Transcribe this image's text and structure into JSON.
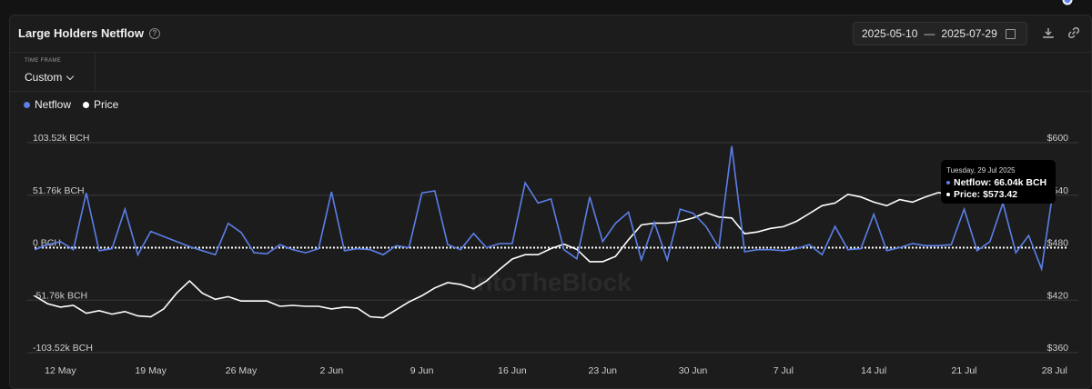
{
  "header": {
    "title": "Large Holders Netflow",
    "date_start": "2025-05-10",
    "date_sep": "—",
    "date_end": "2025-07-29"
  },
  "controls": {
    "timeframe_label": "TIME FRAME",
    "timeframe_value": "Custom"
  },
  "legend": [
    {
      "label": "Netflow",
      "color": "#5b7fe8"
    },
    {
      "label": "Price",
      "color": "#ffffff"
    }
  ],
  "tooltip": {
    "date": "Tuesday, 29 Jul 2025",
    "netflow": "Netflow: 66.04k BCH",
    "price": "Price: $573.42"
  },
  "watermark": "IntoTheBlock",
  "chart_data": {
    "type": "line",
    "x": [
      "May 10",
      "May 11",
      "May 12",
      "May 13",
      "May 14",
      "May 15",
      "May 16",
      "May 17",
      "May 18",
      "May 19",
      "May 20",
      "May 21",
      "May 22",
      "May 23",
      "May 24",
      "May 25",
      "May 26",
      "May 27",
      "May 28",
      "May 29",
      "May 30",
      "May 31",
      "Jun 1",
      "Jun 2",
      "Jun 3",
      "Jun 4",
      "Jun 5",
      "Jun 6",
      "Jun 7",
      "Jun 8",
      "Jun 9",
      "Jun 10",
      "Jun 11",
      "Jun 12",
      "Jun 13",
      "Jun 14",
      "Jun 15",
      "Jun 16",
      "Jun 17",
      "Jun 18",
      "Jun 19",
      "Jun 20",
      "Jun 21",
      "Jun 22",
      "Jun 23",
      "Jun 24",
      "Jun 25",
      "Jun 26",
      "Jun 27",
      "Jun 28",
      "Jun 29",
      "Jun 30",
      "Jul 1",
      "Jul 2",
      "Jul 3",
      "Jul 4",
      "Jul 5",
      "Jul 6",
      "Jul 7",
      "Jul 8",
      "Jul 9",
      "Jul 10",
      "Jul 11",
      "Jul 12",
      "Jul 13",
      "Jul 14",
      "Jul 15",
      "Jul 16",
      "Jul 17",
      "Jul 18",
      "Jul 19",
      "Jul 20",
      "Jul 21",
      "Jul 22",
      "Jul 23",
      "Jul 24",
      "Jul 25",
      "Jul 26",
      "Jul 27",
      "Jul 28",
      "Jul 29"
    ],
    "x_tick_labels": [
      "12 May",
      "19 May",
      "26 May",
      "2 Jun",
      "9 Jun",
      "16 Jun",
      "23 Jun",
      "30 Jun",
      "7 Jul",
      "14 Jul",
      "21 Jul",
      "28 Jul"
    ],
    "x_tick_indices": [
      2,
      9,
      16,
      23,
      30,
      37,
      44,
      51,
      58,
      65,
      72,
      79
    ],
    "series": [
      {
        "name": "Netflow",
        "axis": "left",
        "unit": "BCH",
        "color": "#5b7fe8",
        "values": [
          -2,
          3,
          6,
          -2,
          54,
          -3,
          -1,
          38,
          -7,
          16,
          11,
          6,
          1,
          -3,
          -7,
          24,
          15,
          -5,
          -6,
          3,
          -2,
          -5,
          -1,
          55,
          -3,
          -1,
          -2,
          -7,
          2,
          0,
          54,
          56,
          3,
          -2,
          14,
          0,
          4,
          4,
          64,
          44,
          48,
          -2,
          -11,
          50,
          6,
          24,
          35,
          -12,
          25,
          -12,
          38,
          34,
          21,
          0,
          100,
          -4,
          -2,
          -2,
          -3,
          -1,
          3,
          -7,
          21,
          -2,
          -1,
          33,
          -3,
          0,
          4,
          2,
          2,
          3,
          38,
          -3,
          6,
          44,
          -5,
          12,
          -21,
          66
        ],
        "note": "values in thousands of BCH"
      },
      {
        "name": "Price",
        "axis": "right",
        "unit": "USD",
        "color": "#ffffff",
        "values": [
          425,
          416,
          412,
          414,
          405,
          408,
          404,
          407,
          402,
          401,
          410,
          428,
          442,
          428,
          421,
          424,
          419,
          419,
          419,
          413,
          414,
          413,
          413,
          410,
          412,
          411,
          401,
          400,
          409,
          418,
          425,
          434,
          440,
          438,
          433,
          442,
          455,
          467,
          472,
          472,
          479,
          484,
          478,
          464,
          464,
          470,
          489,
          506,
          508,
          508,
          510,
          514,
          520,
          515,
          514,
          496,
          498,
          502,
          504,
          510,
          519,
          528,
          531,
          541,
          538,
          532,
          528,
          535,
          532,
          538,
          543,
          541,
          550,
          554,
          547,
          560,
          572,
          572,
          576,
          573.42
        ]
      }
    ],
    "y_left": {
      "ticks": [
        "103.52k BCH",
        "51.76k BCH",
        "0 BCH",
        "-51.76k BCH",
        "-103.52k BCH"
      ],
      "range": [
        -103.52,
        103.52
      ]
    },
    "y_right": {
      "ticks": [
        "$600",
        "$540",
        "$480",
        "$420",
        "$360"
      ],
      "range": [
        360,
        600
      ]
    },
    "grid": true,
    "legend_position": "top-left"
  }
}
